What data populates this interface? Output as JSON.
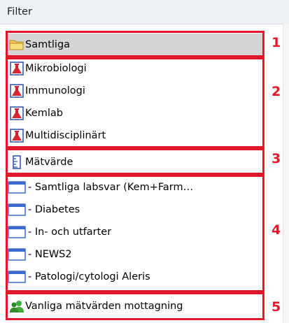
{
  "header": {
    "title": "Filter"
  },
  "groups": [
    {
      "number": "1",
      "items": [
        {
          "label": "Samtliga",
          "icon": "folder-icon",
          "selected": true
        }
      ]
    },
    {
      "number": "2",
      "items": [
        {
          "label": "Mikrobiologi",
          "icon": "flask-icon"
        },
        {
          "label": "Immunologi",
          "icon": "flask-icon"
        },
        {
          "label": "Kemlab",
          "icon": "flask-icon"
        },
        {
          "label": "Multidisciplinärt",
          "icon": "flask-icon"
        }
      ]
    },
    {
      "number": "3",
      "items": [
        {
          "label": "Mätvärde",
          "icon": "ruler-icon"
        }
      ]
    },
    {
      "number": "4",
      "items": [
        {
          "label": "- Samtliga labsvar (Kem+Farm…",
          "icon": "window-icon"
        },
        {
          "label": "- Diabetes",
          "icon": "window-icon"
        },
        {
          "label": "- In- och utfarter",
          "icon": "window-icon"
        },
        {
          "label": "- NEWS2",
          "icon": "window-icon"
        },
        {
          "label": "- Patologi/cytologi Aleris",
          "icon": "window-icon"
        }
      ]
    },
    {
      "number": "5",
      "items": [
        {
          "label": "Vanliga mätvärden mottagning",
          "icon": "users-icon"
        }
      ]
    }
  ],
  "colors": {
    "annotation": "#e2182a",
    "selected_row": "#d6d6d6",
    "header_bg": "#eef1f5"
  }
}
